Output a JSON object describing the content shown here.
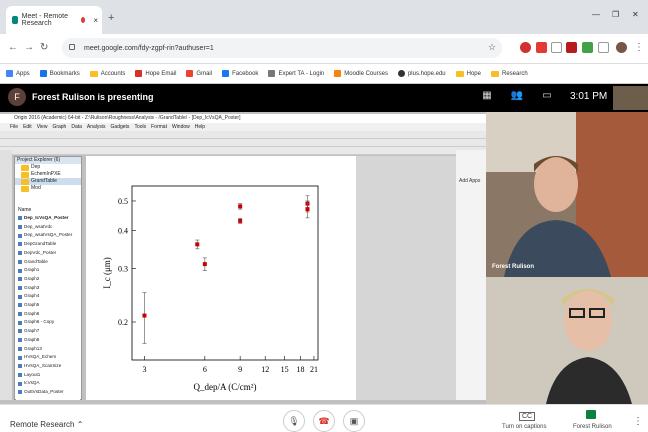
{
  "browser": {
    "tab_title": "Meet - Remote Research",
    "new_tab": "+",
    "url": "meet.google.com/fdy-zgpf-rin?authuser=1",
    "bookmarks": [
      "Apps",
      "Bookmarks",
      "Accounts",
      "Hope Email",
      "Gmail",
      "Facebook",
      "Expert TA - Login",
      "Moodle Courses",
      "plus.hope.edu",
      "Hope",
      "Research"
    ]
  },
  "meet": {
    "presenter_initial": "F",
    "presenting_text": "Forest Rulison is presenting",
    "time": "3:01 PM",
    "participants": [
      "Forest Rulison",
      ""
    ],
    "meeting_name": "Remote Research",
    "captions_label": "Turn on captions",
    "present_label": "Forest Rulison"
  },
  "origin": {
    "title": "Origin 2016 (Academic) 64-bit - Z:\\Rulison\\Roughness\\Analysis - /GrandTable/ - [Dep_IcVsQA_Poster]",
    "menus": [
      "File",
      "Edit",
      "View",
      "Graph",
      "Data",
      "Analysis",
      "Gadgets",
      "Tools",
      "Format",
      "Window",
      "Help"
    ],
    "project_explorer": "Project Explorer (6)",
    "folders": [
      "Dep",
      "EchemInPXE",
      "GrandTable",
      "Mod"
    ],
    "name_header": "Name",
    "items": [
      "Dep_IcVsQA_Poster",
      "Dep_wsatVdc",
      "Dep_wsatVsQA_Poster",
      "DepGrandTable",
      "DepVdc_Poster",
      "GrandTable",
      "Graph1",
      "Graph2",
      "Graph3",
      "Graph4",
      "Graph5",
      "Graph6",
      "Graph6 - Copy",
      "Graph7",
      "Graph8",
      "Graph13",
      "HVsQA_Echem",
      "HVsQA_ScanSize",
      "Layout1",
      "IcVsQA",
      "OuttVsData_Poster"
    ],
    "add_apps": "Add Apps"
  },
  "chart_data": {
    "type": "scatter",
    "xlabel": "Q_dep/A (C/cm²)",
    "ylabel": "I_c (μm)",
    "xscale": "log",
    "yscale": "log",
    "xlim": [
      2.6,
      22
    ],
    "ylim": [
      0.15,
      0.56
    ],
    "xticks": [
      3,
      6,
      9,
      12,
      15,
      18,
      21
    ],
    "yticks": [
      0.2,
      0.3,
      0.4,
      0.5
    ],
    "points": [
      {
        "x": 3,
        "y": 0.21,
        "err": 0.04
      },
      {
        "x": 5.5,
        "y": 0.36,
        "err": 0.012
      },
      {
        "x": 6,
        "y": 0.31,
        "err": 0.015
      },
      {
        "x": 9,
        "y": 0.48,
        "err": 0.01
      },
      {
        "x": 9,
        "y": 0.43,
        "err": 0.008
      },
      {
        "x": 19.5,
        "y": 0.49,
        "err": 0.03
      },
      {
        "x": 19.5,
        "y": 0.47,
        "err": 0.03
      }
    ],
    "color": "#cc0000"
  }
}
